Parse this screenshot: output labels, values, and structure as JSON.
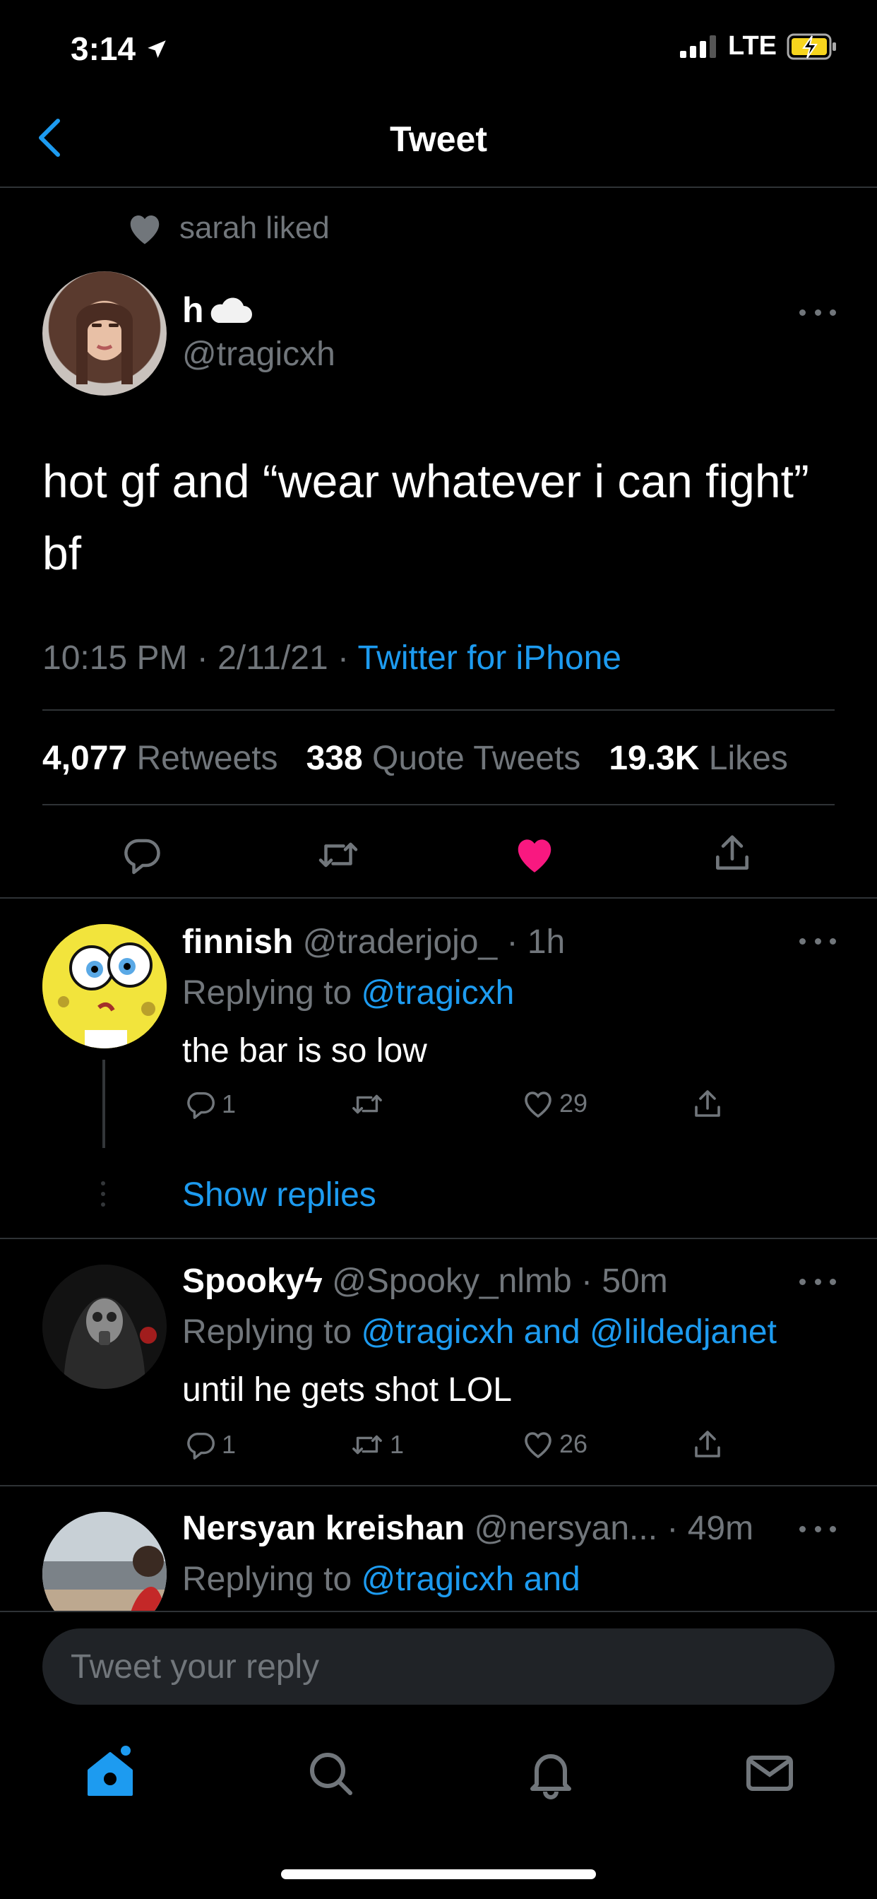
{
  "status_bar": {
    "time": "3:14",
    "network": "LTE"
  },
  "header": {
    "title": "Tweet"
  },
  "social_context": {
    "text": "sarah liked"
  },
  "tweet": {
    "author_name": "h",
    "author_handle": "@tragicxh",
    "text": "hot gf and “wear whatever i can fight” bf",
    "time": "10:15 PM",
    "date": "2/11/21",
    "source": "Twitter for iPhone",
    "retweets": "4,077",
    "retweets_label": "Retweets",
    "quote_tweets": "338",
    "quote_tweets_label": "Quote Tweets",
    "likes": "19.3K",
    "likes_label": "Likes",
    "liked": true
  },
  "replies": [
    {
      "name": "finnish",
      "handle": "@traderjojo_",
      "time": "1h",
      "replying_label": "Replying to",
      "replying_to": "@tragicxh",
      "text": "the bar is so low",
      "reply_count": "1",
      "retweet_count": "",
      "like_count": "29",
      "show_replies": "Show replies"
    },
    {
      "name": "Spookyϟ",
      "handle": "@Spooky_nlmb",
      "time": "50m",
      "replying_label": "Replying to",
      "replying_to": "@tragicxh and @lildedjanet",
      "text": "until he gets shot LOL",
      "reply_count": "1",
      "retweet_count": "1",
      "like_count": "26"
    },
    {
      "name": "Nersyan kreishan",
      "handle": "@nersyan...",
      "time": "49m",
      "replying_label": "Replying to",
      "replying_to": "@tragicxh and"
    }
  ],
  "compose": {
    "placeholder": "Tweet your reply"
  },
  "colors": {
    "accent": "#1d9bf0",
    "like": "#f91880",
    "background": "#000000"
  }
}
